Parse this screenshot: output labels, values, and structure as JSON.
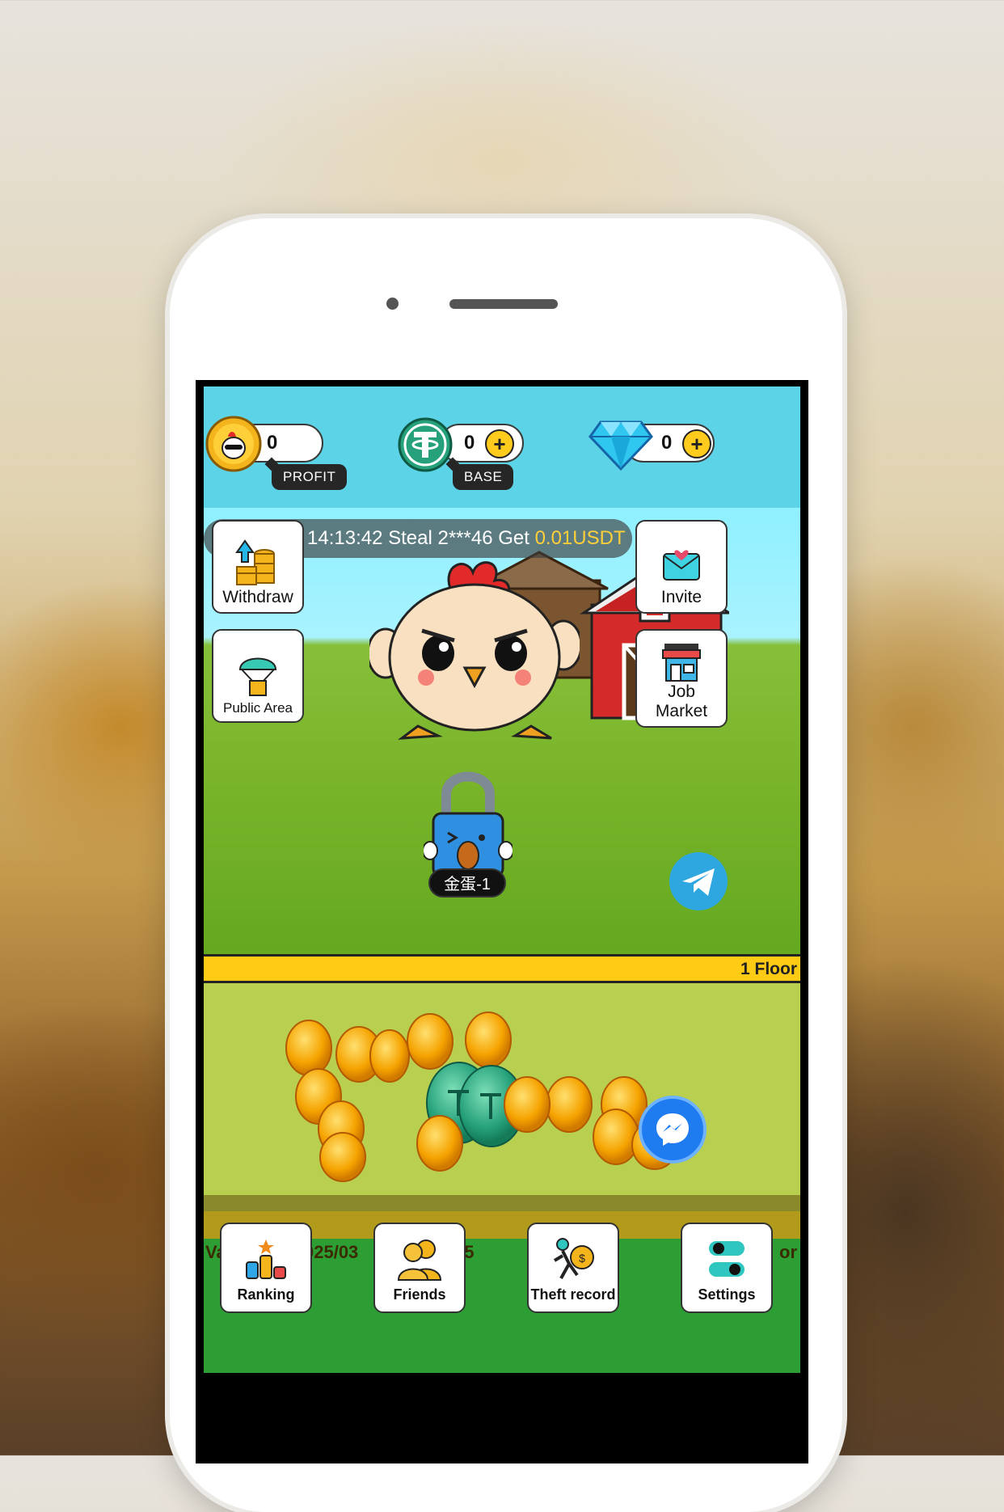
{
  "balances": {
    "profit": {
      "value": "0",
      "tag": "PROFIT"
    },
    "base": {
      "value": "0",
      "tag": "BASE"
    },
    "diamond": {
      "value": "0"
    }
  },
  "ticker": {
    "text": "3 14:13:42 Steal 2***46 Get ",
    "highlight": "0.01USDT"
  },
  "side_buttons": {
    "withdraw": "Withdraw",
    "public_area": "Public Area",
    "invite": "Invite",
    "job_market": "Job\nMarket"
  },
  "lock": {
    "name": "金蛋-1"
  },
  "floor": {
    "label": "1 Floor"
  },
  "bottom_ticker": {
    "left": "Va",
    "middle": "025/03",
    "right": "45",
    "far_right": "or"
  },
  "nav": {
    "ranking": "Ranking",
    "friends": "Friends",
    "theft_record": "Theft record",
    "settings": "Settings"
  },
  "colors": {
    "sky": "#5cd3e6",
    "floor_bar": "#ffcb14",
    "accent_usdt": "#ffcf3a",
    "nav_bg": "#2d9e34"
  }
}
